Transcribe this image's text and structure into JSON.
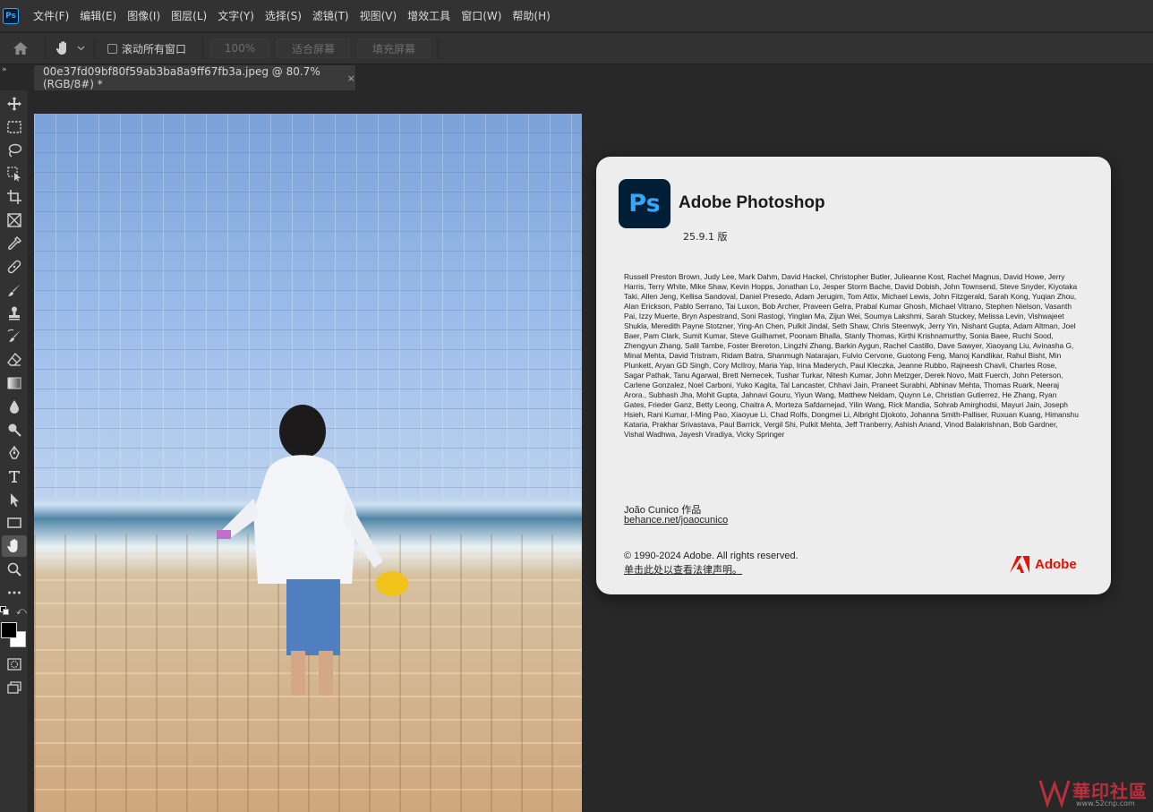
{
  "app": {
    "logo_text": "Ps",
    "menu": [
      "文件(F)",
      "编辑(E)",
      "图像(I)",
      "图层(L)",
      "文字(Y)",
      "选择(S)",
      "滤镜(T)",
      "视图(V)",
      "增效工具",
      "窗口(W)",
      "帮助(H)"
    ]
  },
  "options_bar": {
    "scroll_all_label": "滚动所有窗口",
    "zoom_value": "100%",
    "fit_screen_label": "适合屏幕",
    "fill_screen_label": "填充屏幕"
  },
  "document_tab": {
    "title": "00e37fd09bf80f59ab3ba8a9ff67fb3a.jpeg @ 80.7%(RGB/8#) *",
    "close_glyph": "×"
  },
  "tools": [
    "move-tool",
    "marquee-tool",
    "lasso-tool",
    "object-selection-tool",
    "crop-tool",
    "frame-tool",
    "eyedropper-tool",
    "healing-brush-tool",
    "brush-tool",
    "clone-stamp-tool",
    "history-brush-tool",
    "eraser-tool",
    "gradient-tool",
    "blur-tool",
    "dodge-tool",
    "pen-tool",
    "type-tool",
    "path-selection-tool",
    "rectangle-tool",
    "hand-tool",
    "zoom-tool",
    "more-tools"
  ],
  "active_tool": "hand-tool",
  "colors": {
    "foreground": "#000000",
    "background": "#ffffff",
    "ps_blue": "#31a8ff",
    "ps_dark": "#001e36",
    "adobe_red": "#eb1000"
  },
  "about": {
    "icon_text": "Ps",
    "product_name": "Adobe Photoshop",
    "version": "25.9.1 版",
    "credits": "Russell Preston Brown, Judy Lee, Mark Dahm, David Hackel, Christopher Butler, Julieanne Kost, Rachel Magnus, David Howe, Jerry Harris, Terry White, Mike Shaw, Kevin Hopps, Jonathan Lo, Jesper Storm Bache, David Dobish, John Townsend, Steve Snyder, Kiyotaka Taki, Allen Jeng, Kellisa Sandoval, Daniel Presedo, Adam Jerugim, Tom Attix, Michael Lewis, John Fitzgerald, Sarah Kong, Yuqian Zhou, Alan Erickson, Pablo Serrano, Tai Luxon, Bob Archer, Praveen Gelra, Prabal Kumar Ghosh, Michael Vitrano, Stephen Nielson, Vasanth Pai, Izzy Muerte, Bryn Aspestrand, Soni Rastogi, Yinglan Ma, Zijun Wei, Soumya Lakshmi, Sarah Stuckey, Melissa Levin, Vishwajeet Shukla, Meredith Payne Stotzner, Ying-An Chen, Pulkit Jindal, Seth Shaw, Chris Steenwyk, Jerry Yin, Nishant Gupta, Adam Altman, Joel Baer, Pam Clark, Sumit Kumar, Steve Guilhamet, Poonam Bhalla, Stanly Thomas, Kirthi Krishnamurthy, Sonia Baee, Ruchi Sood, Zhengyun Zhang, Salil Tambe, Foster Brereton, Lingzhi Zhang, Barkin Aygun, Rachel Castillo, Dave Sawyer, Xiaoyang Liu, Avinasha G, Minal Mehta, David Tristram, Ridam Batra, Shanmugh Natarajan, Fulvio Cervone, Guotong Feng, Manoj Kandlikar, Rahul Bisht, Min Plunkett, Aryan GD Singh, Cory McIlroy, Maria Yap, Irina Maderych, Paul Kleczka, Jeanne Rubbo, Rajneesh Chavli, Charles Rose, Sagar Pathak, Tanu Agarwal, Brett Nemecek, Tushar Turkar, Nitesh Kumar, John Metzger, Derek Novo, Matt Fuerch, John Peterson, Carlene Gonzalez, Noel Carboni, Yuko Kagita, Tal Lancaster, Chhavi Jain, Praneet Surabhi, Abhinav Mehta, Thomas Ruark, Neeraj Arora., Subhash Jha, Mohit Gupta, Jahnavi Gouru, Yiyun Wang, Matthew Neldam, Quynn Le, Christian Gutierrez, He Zhang, Ryan Gates, Frieder Ganz, Betty Leong, Chaitra A, Morteza Safdarnejad, Yilin Wang, Rick Mandia, Sohrab Amirghodsi, Mayuri Jain, Joseph Hsieh, Rani Kumar, I-Ming Pao, Xiaoyue Li, Chad Rolfs, Dongmei Li, Albright Djokoto, Johanna Smith-Palliser, Ruxuan Kuang, Himanshu Kataria, Prakhar Srivastava, Paul Barrick, Vergil Shi, Pulkit Mehta, Jeff Tranberry, Ashish Anand, Vinod Balakrishnan, Bob Gardner, Vishal Wadhwa, Jayesh Viradiya, Vicky Springer",
    "artist_credit": "João Cunico 作品",
    "artist_link": "behance.net/joaocunico",
    "copyright": "© 1990-2024 Adobe. All rights reserved.",
    "legal_link": "单击此处以查看法律声明。",
    "adobe_wordmark": "Adobe"
  },
  "watermark": {
    "text": "華印社區",
    "url": "www.52cnp.com"
  }
}
